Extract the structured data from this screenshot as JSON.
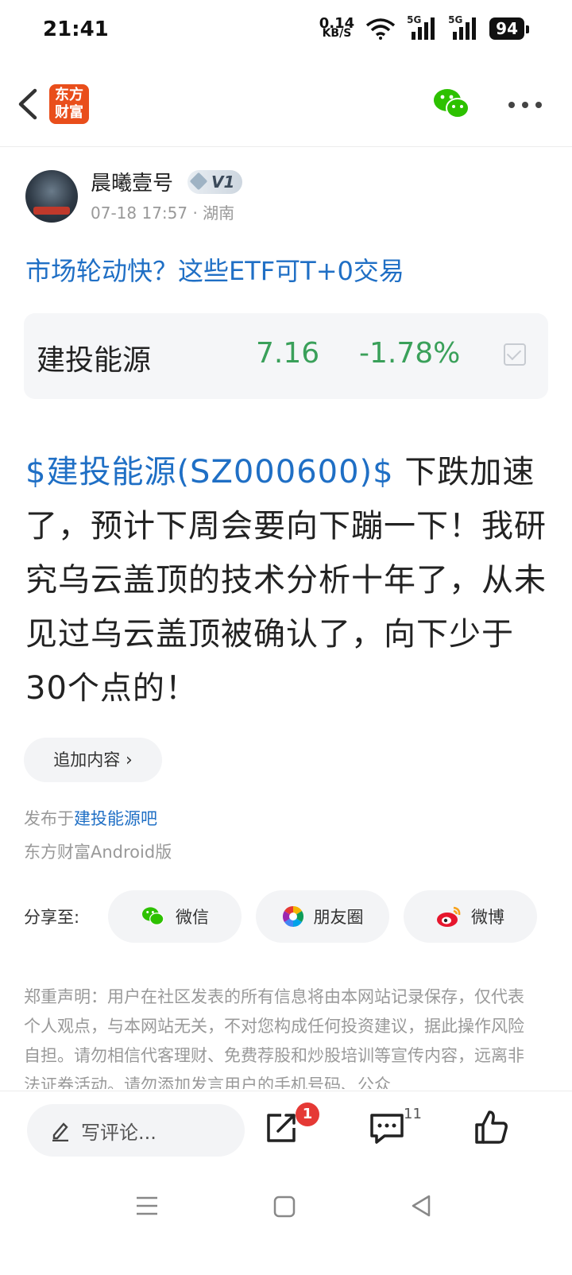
{
  "status": {
    "time": "21:41",
    "net_speed": "0.14",
    "net_unit": "KB/S",
    "signal1": "5G",
    "signal2": "5G",
    "battery": "94"
  },
  "header": {
    "logo_line1": "东方",
    "logo_line2": "财富"
  },
  "author": {
    "name": "晨曦壹号",
    "level": "V1",
    "meta": "07-18 17:57 · 湖南"
  },
  "post": {
    "title": "市场轮动快？这些ETF可T+0交易",
    "stock": {
      "name": "建投能源",
      "price": "7.16",
      "change": "-1.78%"
    },
    "tag": "$建投能源(SZ000600)$",
    "body": " 下跌加速了，预计下周会要向下蹦一下！我研究乌云盖顶的技术分析十年了，从未见过乌云盖顶被确认了，向下少于30个点的！",
    "add_content": "追加内容",
    "published_prefix": "发布于",
    "published_bar": "建投能源吧",
    "client": "东方财富Android版"
  },
  "share": {
    "label": "分享至:",
    "wechat": "微信",
    "moments": "朋友圈",
    "weibo": "微博"
  },
  "disclaimer": "郑重声明：用户在社区发表的所有信息将由本网站记录保存，仅代表个人观点，与本网站无关，不对您构成任何投资建议，据此操作风险自担。请勿相信代客理财、免费荐股和炒股培训等宣传内容，远离非法证券活动。请勿添加发言用户的手机号码、公众",
  "bottom": {
    "comment_placeholder": "写评论...",
    "share_badge": "1",
    "comment_count": "11"
  },
  "colors": {
    "link_blue": "#1f6fc5",
    "down_green": "#3aa05a",
    "logo_orange": "#e94e1b",
    "badge_red": "#e53935"
  }
}
